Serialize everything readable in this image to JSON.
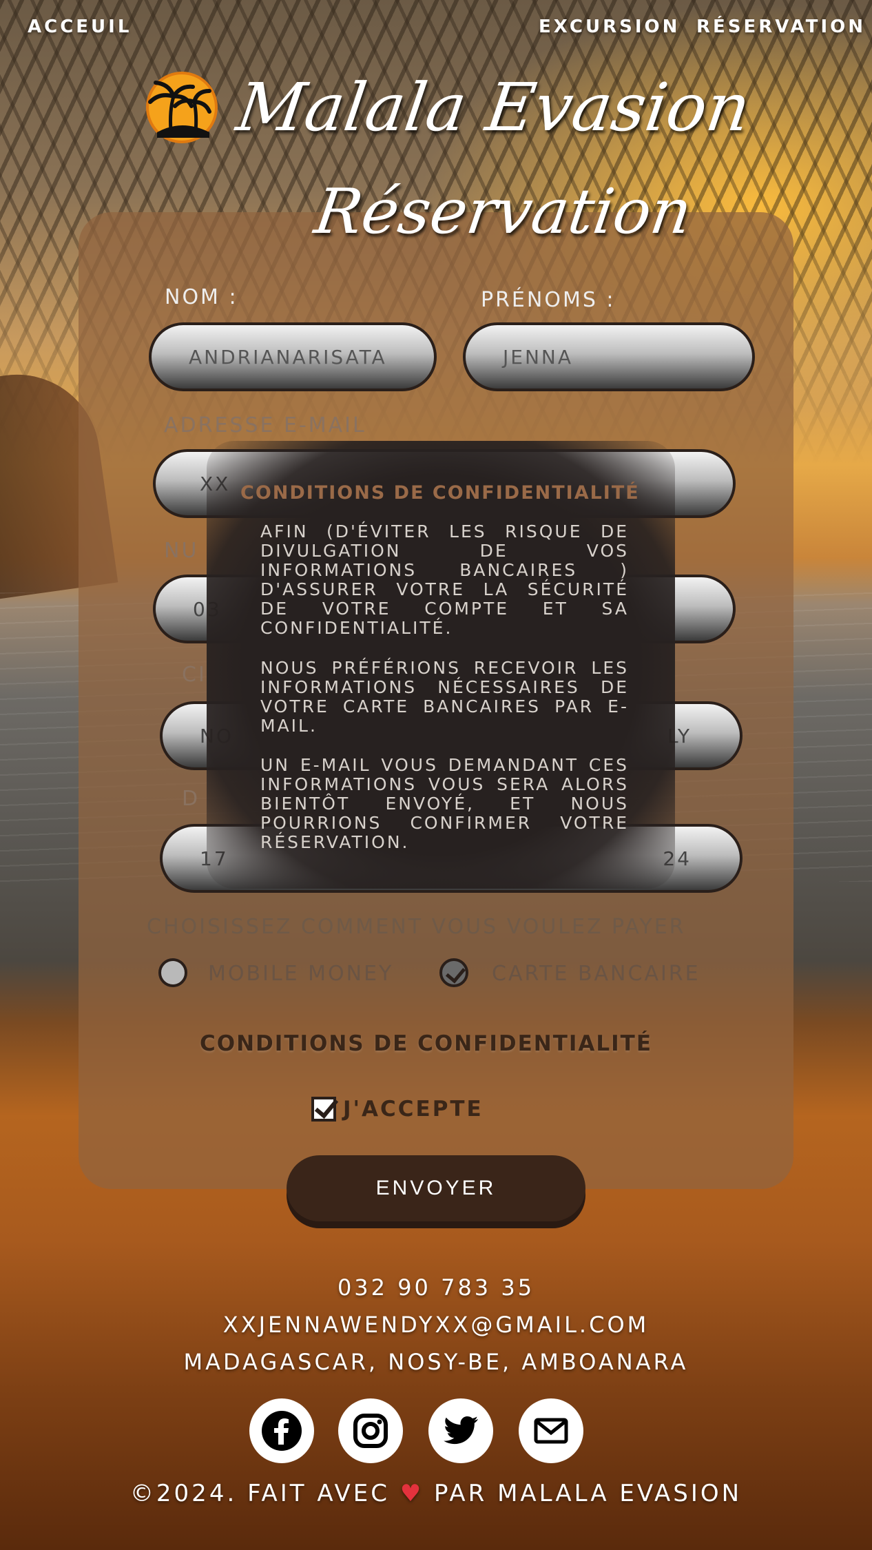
{
  "nav": {
    "home": "ACCEUIL",
    "excursion": "EXCURSION",
    "reservation": "RÉSERVATION"
  },
  "header": {
    "brand": "Malala Evasion",
    "title": "Réservation"
  },
  "form": {
    "nom_label": "NOM :",
    "nom_value": "ANDRIANARISATA",
    "prenoms_label": "PRÉNOMS :",
    "prenoms_value": "JENNA",
    "email_label": "ADRESSE E-MAIL",
    "email_value": "XX",
    "phone_label": "NU",
    "phone_value": "03",
    "circuit_label": "CI",
    "circuit_value": "NO",
    "circuit_value_end": "LY",
    "date_label": "D",
    "date_value": "17",
    "date_value_end": "24",
    "payment_question": "CHOISISSEZ COMMENT VOUS VOULEZ PAYER",
    "payment_options": [
      {
        "label": "MOBILE MONEY",
        "checked": false
      },
      {
        "label": "CARTE BANCAIRE",
        "checked": true
      }
    ],
    "conditions_link": "CONDITIONS DE CONFIDENTIALITÉ",
    "accept_label": "J'ACCEPTE",
    "accept_checked": true,
    "submit_label": "ENVOYER"
  },
  "modal": {
    "title": "CONDITIONS DE CONFIDENTIALITÉ",
    "paragraphs": [
      "AFIN (D'ÉVITER LES RISQUE DE DIVULGATION DE VOS INFORMATIONS BANCAIRES ) D'ASSURER VOTRE LA SÉCURITÉ DE VOTRE COMPTE ET SA CONFIDENTIALITÉ.",
      "NOUS PRÉFÉRIONS RECEVOIR LES INFORMATIONS NÉCESSAIRES DE VOTRE CARTE BANCAIRES PAR E-MAIL.",
      "UN E-MAIL VOUS DEMANDANT CES INFORMATIONS VOUS SERA ALORS BIENTÔT ENVOYÉ, ET NOUS POURRIONS CONFIRMER VOTRE RÉSERVATION."
    ]
  },
  "footer": {
    "phone": "032 90 783 35",
    "email": "XXJENNAWENDYXX@GMAIL.COM",
    "address": "MADAGASCAR, NOSY-BE, AMBOANARA",
    "socials": [
      "facebook-icon",
      "instagram-icon",
      "twitter-icon",
      "mail-icon"
    ],
    "copyright_before": "©2024. FAIT AVEC",
    "copyright_after": "PAR MALALA EVASION",
    "heart_color": "#e3323d"
  }
}
